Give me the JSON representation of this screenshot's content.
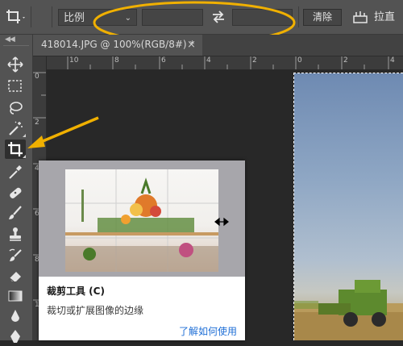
{
  "options_bar": {
    "ratio_select": "比例",
    "clear_button": "清除",
    "straighten_label": "拉直"
  },
  "document_tab": {
    "title": "418014.JPG @ 100%(RGB/8#) *",
    "close": "×"
  },
  "rulers": {
    "horizontal": [
      "10",
      "8",
      "6",
      "4",
      "2",
      "0",
      "2",
      "4"
    ],
    "vertical": [
      "0",
      "2",
      "4",
      "6",
      "8",
      "1"
    ]
  },
  "tooltip": {
    "title": "裁剪工具 (C)",
    "description": "裁切或扩展图像的边缘",
    "link": "了解如何使用"
  },
  "icons": [
    "crop-icon",
    "move-icon",
    "marquee-icon",
    "lasso-icon",
    "magic-wand-icon",
    "eyedropper-icon",
    "healing-icon",
    "brush-icon",
    "stamp-icon",
    "history-brush-icon",
    "eraser-icon",
    "gradient-icon",
    "pen-icon",
    "blur-icon",
    "swap-icon",
    "straighten-icon"
  ],
  "colors": {
    "panel": "#535353",
    "canvas": "#282828",
    "link": "#1f6fd6",
    "annotation": "#f0b000"
  }
}
